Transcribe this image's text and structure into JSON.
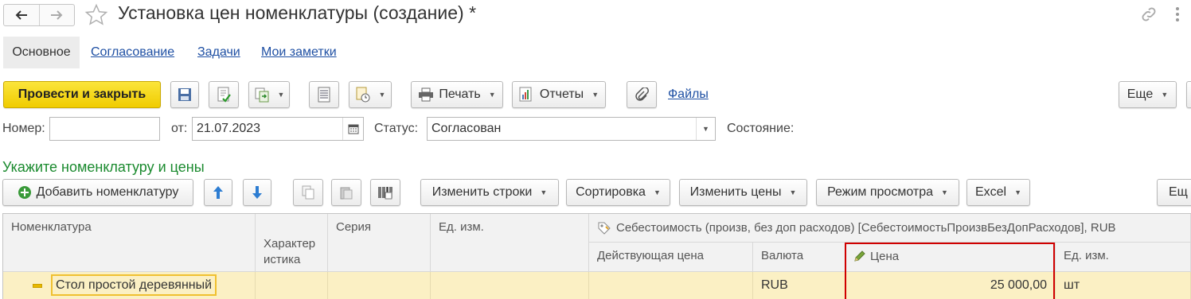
{
  "window": {
    "title": "Установка цен номенклатуры (создание) *"
  },
  "tabs": [
    {
      "label": "Основное"
    },
    {
      "label": "Согласование"
    },
    {
      "label": "Задачи"
    },
    {
      "label": "Мои заметки"
    }
  ],
  "toolbar": {
    "post_close": "Провести и закрыть",
    "print": "Печать",
    "reports": "Отчеты",
    "files": "Файлы",
    "more": "Еще"
  },
  "form": {
    "number_label": "Номер:",
    "number_value": "",
    "date_label": "от:",
    "date_value": "21.07.2023",
    "status_label": "Статус:",
    "status_value": "Согласован",
    "state_label": "Состояние:"
  },
  "section": {
    "title": "Укажите номенклатуру и цены"
  },
  "table_toolbar": {
    "add_item": "Добавить номенклатуру",
    "change_rows": "Изменить строки",
    "sort": "Сортировка",
    "change_prices": "Изменить цены",
    "view_mode": "Режим просмотра",
    "excel": "Excel",
    "more_cut": "Ещ"
  },
  "table": {
    "headers": {
      "item": "Номенклатура",
      "characteristic": "Характер\nистика",
      "series": "Серия",
      "unit": "Ед. изм.",
      "group": "Себестоимость (произв, без доп расходов) [СебестоимостьПроизвБезДопРасходов], RUB",
      "current_price": "Действующая цена",
      "currency": "Валюта",
      "price": "Цена",
      "unit2": "Ед. изм."
    },
    "rows": [
      {
        "item": "Стол простой деревянный",
        "characteristic": "",
        "series": "",
        "unit": "",
        "current_price": "",
        "currency": "RUB",
        "price": "25 000,00",
        "unit2": "шт"
      }
    ]
  },
  "colors": {
    "accent_link": "#1e4fa3",
    "section_green": "#1a8a2e",
    "primary_button": "#f5d40f",
    "row_highlight": "#fbf0c4",
    "focus_border": "#d00000"
  }
}
